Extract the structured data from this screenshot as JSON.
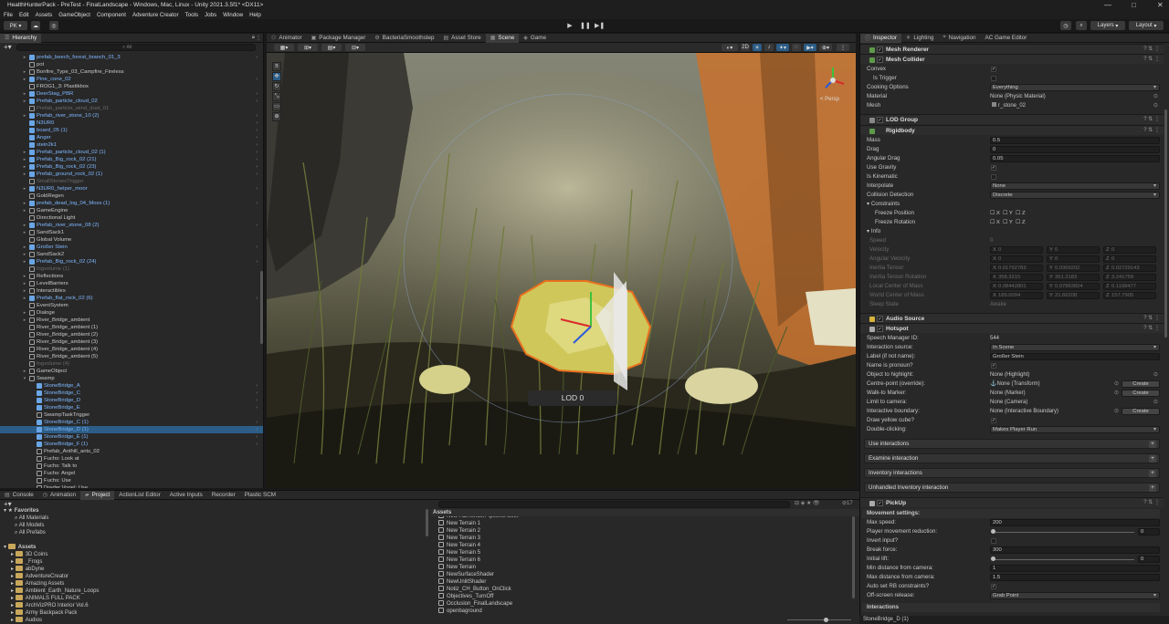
{
  "window": {
    "title": "HealthHunterPack - PreTest - FinalLandscape - Windows, Mac, Linux - Unity 2021.3.5f1* <DX11>"
  },
  "menu": [
    "File",
    "Edit",
    "Assets",
    "GameObject",
    "Component",
    "Adventure Creator",
    "Tools",
    "Jobs",
    "Window",
    "Help"
  ],
  "toolbar": {
    "account": "PK ▾",
    "layers": "Layers",
    "layout": "Layout"
  },
  "hierarchy": {
    "tab": "Hierarchy",
    "search_placeholder": "All",
    "rows": [
      {
        "label": "pot",
        "depth": 1,
        "kind": "go"
      },
      {
        "label": "Bonfire_Type_03_Campfire_Fireless",
        "depth": 1,
        "kind": "go"
      },
      {
        "label": "Pine_cone_02",
        "depth": 1,
        "kind": "prefab"
      },
      {
        "label": "FROG1_3: Plastikbox",
        "depth": 1,
        "kind": "go"
      },
      {
        "label": "DeerStag_PBR",
        "depth": 1,
        "kind": "prefab"
      },
      {
        "label": "Prefab_particle_cloud_02",
        "depth": 1,
        "kind": "prefab"
      },
      {
        "label": "Prefab_particle_wind_dust_01",
        "depth": 1,
        "kind": "inactive"
      },
      {
        "label": "Prefab_river_stone_10 (2)",
        "depth": 1,
        "kind": "prefab"
      },
      {
        "label": "N3UR0",
        "depth": 1,
        "kind": "prefab"
      },
      {
        "label": "board_05 (1)",
        "depth": 1,
        "kind": "prefab"
      },
      {
        "label": "Anger",
        "depth": 1,
        "kind": "prefab"
      },
      {
        "label": "stein2k1",
        "depth": 1,
        "kind": "prefab"
      },
      {
        "label": "Prefab_particle_cloud_02 (1)",
        "depth": 1,
        "kind": "prefab"
      },
      {
        "label": "Prefab_Big_rock_02 (21)",
        "depth": 1,
        "kind": "prefab"
      },
      {
        "label": "Prefab_Big_rock_02 (23)",
        "depth": 1,
        "kind": "prefab"
      },
      {
        "label": "Prefab_ground_rock_02 (1)",
        "depth": 1,
        "kind": "prefab"
      },
      {
        "label": "SmallStonesTrigger",
        "depth": 1,
        "kind": "inactive"
      },
      {
        "label": "N3UR0_helper_moor",
        "depth": 1,
        "kind": "prefab"
      },
      {
        "label": "GoldRegen",
        "depth": 1,
        "kind": "go"
      },
      {
        "label": "prefab_dead_log_04_Moss (1)",
        "depth": 1,
        "kind": "prefab"
      },
      {
        "label": "GameEngine",
        "depth": 1,
        "kind": "go"
      },
      {
        "label": "Directional Light",
        "depth": 1,
        "kind": "go"
      },
      {
        "label": "Prefab_river_stone_08 (2)",
        "depth": 1,
        "kind": "prefab"
      },
      {
        "label": "SandSack1",
        "depth": 1,
        "kind": "go"
      },
      {
        "label": "Global Volume",
        "depth": 1,
        "kind": "go"
      },
      {
        "label": "Großer Stein",
        "depth": 1,
        "kind": "prefab"
      },
      {
        "label": "SandSack2",
        "depth": 1,
        "kind": "go"
      },
      {
        "label": "Prefab_Big_rock_02 (24)",
        "depth": 1,
        "kind": "prefab"
      },
      {
        "label": "fogvolume (1)",
        "depth": 1,
        "kind": "inactive"
      },
      {
        "label": "Reflections",
        "depth": 1,
        "kind": "go"
      },
      {
        "label": "LevelBarriers",
        "depth": 1,
        "kind": "go"
      },
      {
        "label": "Interactibles",
        "depth": 1,
        "kind": "go"
      },
      {
        "label": "Prefab_flat_rock_02 (6)",
        "depth": 1,
        "kind": "prefab"
      },
      {
        "label": "EventSystem",
        "depth": 1,
        "kind": "go"
      },
      {
        "label": "Dialoge",
        "depth": 1,
        "kind": "go"
      },
      {
        "label": "River_Bridge_ambient",
        "depth": 1,
        "kind": "go"
      },
      {
        "label": "River_Bridge_ambient (1)",
        "depth": 1,
        "kind": "go"
      },
      {
        "label": "River_Bridge_ambient (2)",
        "depth": 1,
        "kind": "go"
      },
      {
        "label": "River_Bridge_ambient (3)",
        "depth": 1,
        "kind": "go"
      },
      {
        "label": "River_Bridge_ambient (4)",
        "depth": 1,
        "kind": "go"
      },
      {
        "label": "River_Bridge_ambient (5)",
        "depth": 1,
        "kind": "go"
      },
      {
        "label": "fogvolume (4)",
        "depth": 1,
        "kind": "inactive"
      },
      {
        "label": "GameObject",
        "depth": 1,
        "kind": "go"
      },
      {
        "label": "Swamp",
        "depth": 1,
        "kind": "go"
      },
      {
        "label": "StoneBridge_A",
        "depth": 2,
        "kind": "prefab"
      },
      {
        "label": "StoneBridge_C",
        "depth": 2,
        "kind": "prefab"
      },
      {
        "label": "StoneBridge_D",
        "depth": 2,
        "kind": "prefab"
      },
      {
        "label": "StoneBridge_E",
        "depth": 2,
        "kind": "prefab"
      },
      {
        "label": "SwampTaskTrigger",
        "depth": 2,
        "kind": "go"
      },
      {
        "label": "StoneBridge_C (1)",
        "depth": 2,
        "kind": "prefab"
      },
      {
        "label": "StoneBridge_D (1)",
        "depth": 2,
        "kind": "prefab",
        "selected": true
      },
      {
        "label": "StoneBridge_E (1)",
        "depth": 2,
        "kind": "prefab"
      },
      {
        "label": "StoneBridge_F (1)",
        "depth": 2,
        "kind": "prefab"
      },
      {
        "label": "Prefab_Anthill_ants_02",
        "depth": 2,
        "kind": "go"
      },
      {
        "label": "Fuchs: Look at",
        "depth": 2,
        "kind": "go"
      },
      {
        "label": "Fuchs: Talk to",
        "depth": 2,
        "kind": "go"
      },
      {
        "label": "Fuchs: Angel",
        "depth": 2,
        "kind": "go"
      },
      {
        "label": "Fuchs: Use",
        "depth": 2,
        "kind": "go"
      },
      {
        "label": "Dreder Vogel: Use",
        "depth": 2,
        "kind": "go"
      }
    ],
    "top_rows": [
      {
        "label": "prefab_beech_forest_branch_01_3",
        "kind": "prefab"
      }
    ]
  },
  "center_tabs": [
    "Animator",
    "Package Manager",
    "BacteriaSmoothstep",
    "Asset Store",
    "Scene",
    "Game"
  ],
  "scene": {
    "lod_label": "LOD 0",
    "persp": "< Persp",
    "mode_2d": "2D"
  },
  "inspector": {
    "tabs": [
      "Inspector",
      "Lighting",
      "Navigation",
      "AC Game Editor"
    ],
    "mesh_renderer": "Mesh Renderer",
    "mesh_collider": {
      "title": "Mesh Collider",
      "convex": "Convex",
      "is_trigger": "Is Trigger",
      "cooking_options_label": "Cooking Options",
      "cooking_options": "Everything",
      "material_label": "Material",
      "material": "None (Physic Material)",
      "mesh_label": "Mesh",
      "mesh": "r_stone_02"
    },
    "lod_group": "LOD Group",
    "rigidbody": {
      "title": "Rigidbody",
      "mass": "0.5",
      "drag": "0",
      "angular_drag": "0.05",
      "use_gravity": "Use Gravity",
      "is_kinematic": "Is Kinematic",
      "interpolate": "None",
      "collision_detection": "Discrete",
      "constraints": "Constraints",
      "freeze_position": "Freeze Position",
      "freeze_rotation": "Freeze Rotation"
    },
    "rb_labels": {
      "mass": "Mass",
      "drag": "Drag",
      "angular_drag": "Angular Drag",
      "interpolate": "Interpolate",
      "collision_detection": "Collision Detection"
    },
    "info": {
      "title": "Info",
      "speed_label": "Speed",
      "speed": "0",
      "velocity_label": "Velocity",
      "velocity": [
        "0",
        "0",
        "0"
      ],
      "ang_velocity_label": "Angular Velocity",
      "ang_velocity": [
        "0",
        "0",
        "0"
      ],
      "inertia_tensor_label": "Inertia Tensor",
      "inertia_tensor": [
        "0.01792783",
        "0.0369202",
        "0.02729143"
      ],
      "inertia_rot_label": "Inertia Tensor Rotation",
      "inertia_rot": [
        "358.3215",
        "351.3183",
        "3.241759"
      ],
      "local_com_label": "Local Center of Mass",
      "local_com": [
        "0.08442801",
        "0.07883824",
        "0.1108477"
      ],
      "world_com_label": "World Center of Mass",
      "world_com": [
        "189.0094",
        "21.66208",
        "157.7905"
      ],
      "sleep_label": "Sleep State",
      "sleep": "Awake"
    },
    "audio_source": "Audio Source",
    "hotspot": {
      "title": "Hotspot",
      "speech_label": "Speech Manager ID:",
      "speech": "544",
      "source_label": "Interaction source:",
      "source": "In Scene",
      "label_label": "Label (if not name):",
      "label": "Großer Stein",
      "pronoun_label": "Name is pronoun?",
      "highlight_label": "Object to highlight:",
      "highlight": "None (Highlight)",
      "centre_label": "Centre-point (override):",
      "centre": "None (Transform)",
      "walk_label": "Walk-to Marker:",
      "walk": "None (Marker)",
      "camera_label": "Limit to camera:",
      "camera": "None (Camera)",
      "boundary_label": "Interactive boundary:",
      "boundary": "None (Interactive Boundary)",
      "cube_label": "Draw yellow cube?",
      "dbl_label": "Double-clicking:",
      "dbl": "Makes Player Run",
      "create": "Create"
    },
    "folds": [
      "Use interactions",
      "Examine interaction",
      "Inventory interactions",
      "Unhandled Inventory interaction"
    ],
    "pickup": {
      "title": "PickUp",
      "movement": "Movement settings:",
      "max_speed_label": "Max speed:",
      "max_speed": "200",
      "reduction_label": "Player movement reduction:",
      "reduction": "0",
      "invert_label": "Invert input?",
      "break_label": "Break force:",
      "break": "300",
      "lift_label": "Initial lift:",
      "lift": "0",
      "min_label": "Min distance from camera:",
      "min": "1",
      "max_label": "Max distance from camera:",
      "max": "1.5",
      "auto_label": "Auto set RB constraints?",
      "offscreen_label": "Off-screen release:",
      "offscreen": "Grab Point",
      "interactions": "Interactions"
    }
  },
  "bottom": {
    "tabs": [
      "Console",
      "Animation",
      "Project",
      "ActionList Editor",
      "Active Inputs",
      "Recorder",
      "Plastic SCM"
    ],
    "favorites_title": "Favorites",
    "favorites": [
      "All Materials",
      "All Models",
      "All Prefabs"
    ],
    "assets_title": "Assets",
    "folders": [
      "3D Coins",
      "_Frogs",
      "abDyne",
      "AdventureCreator",
      "Amazing Assets",
      "Ambient_Earth_Nature_Loops",
      "ANIMALS FULL PACK",
      "ArchVizPRO Interior Vol.6",
      "Army Backpack Pack",
      "Audios"
    ],
    "assets_header": "Assets",
    "files": [
      "New HDRenderPipelineAsset",
      "New Terrain 1",
      "New Terrain 2",
      "New Terrain 3",
      "New Terrain 4",
      "New Terrain 5",
      "New Terrain 6",
      "New Terrain",
      "NewSurfaceShader",
      "NewUnlitShader",
      "Notiz_CH_Button_OnClick",
      "Objectives_TurnOff",
      "Occlusion_FinalLandscape",
      "openbaground"
    ],
    "count": "17"
  },
  "status": {
    "selection": "StoneBridge_D (1)"
  },
  "colors": {
    "accent": "#2c5d87",
    "prefab": "#7fb8ff",
    "orange": "#e9701e",
    "rock": "#cfc75a"
  }
}
